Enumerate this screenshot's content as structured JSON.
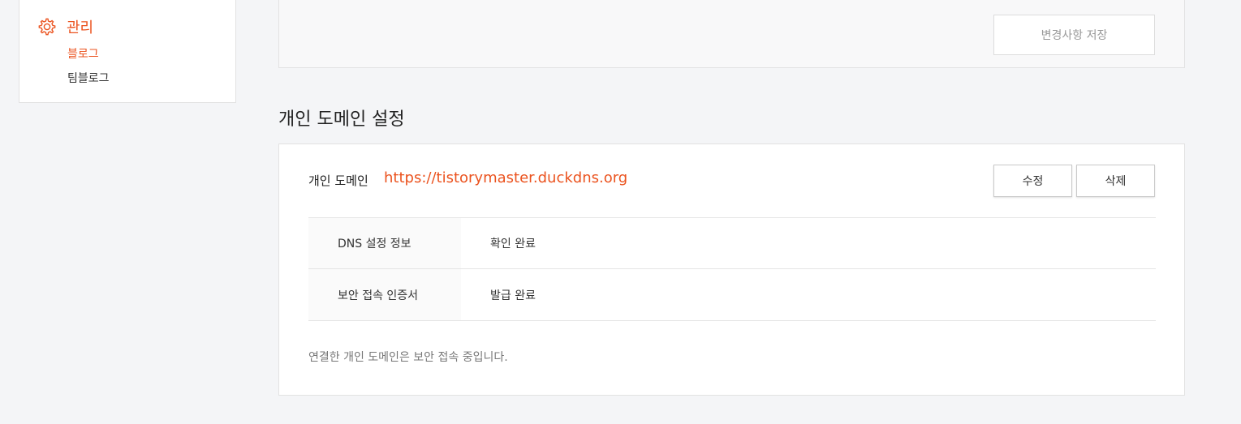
{
  "sidebar": {
    "section_icon": "gear-icon",
    "section_title": "관리",
    "items": [
      {
        "label": "블로그",
        "active": true
      },
      {
        "label": "팀블로그",
        "active": false
      }
    ]
  },
  "top_panel": {
    "save_button_label": "변경사항 저장"
  },
  "custom_domain": {
    "heading": "개인 도메인 설정",
    "label": "개인 도메인",
    "url": "https://tistorymaster.duckdns.org",
    "edit_button_label": "수정",
    "delete_button_label": "삭제",
    "rows": [
      {
        "label": "DNS 설정 정보",
        "value": "확인 완료"
      },
      {
        "label": "보안 접속 인증서",
        "value": "발급 완료"
      }
    ],
    "note": "연결한 개인 도메인은 보안 접속 중입니다."
  },
  "colors": {
    "accent": "#eb531f",
    "background": "#f4f5f7"
  }
}
